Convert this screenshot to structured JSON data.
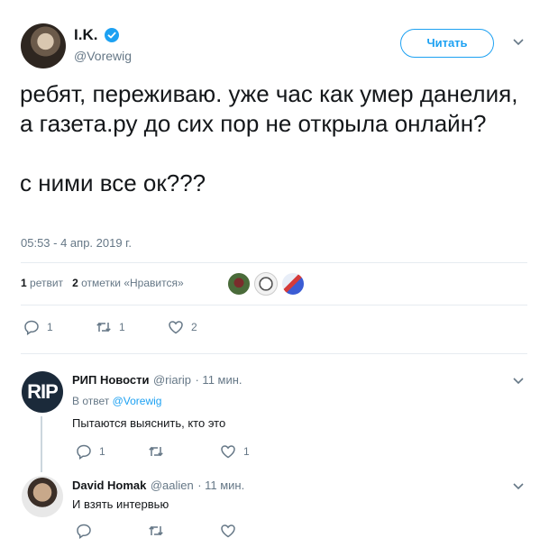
{
  "tweet": {
    "author_name": "I.K.",
    "author_handle": "@Vorewig",
    "follow_label": "Читать",
    "text": "ребят, переживаю. уже час как умер данелия, а газета.ру до сих пор не открыла онлайн?\n\nс ними все ок???",
    "timestamp": "05:53 - 4 апр. 2019 г.",
    "retweets_count": "1",
    "retweets_label": "ретвит",
    "likes_count": "2",
    "likes_label": "отметки «Нравится»",
    "actions": {
      "replies": "1",
      "retweets": "1",
      "likes": "2"
    }
  },
  "replies": [
    {
      "name": "РИП Новости",
      "handle": "@riarip",
      "time": "· 11 мин.",
      "reply_to_prefix": "В ответ",
      "reply_to_handle": "@Vorewig",
      "avatar_text": "RIP",
      "text": "Пытаются выяснить, кто это",
      "actions": {
        "replies": "1",
        "retweets": "",
        "likes": "1"
      }
    },
    {
      "name": "David Homak",
      "handle": "@aalien",
      "time": "· 11 мин.",
      "text": "И взять интервью",
      "actions": {
        "replies": "",
        "retweets": "",
        "likes": ""
      }
    }
  ],
  "colors": {
    "accent": "#1da1f2",
    "muted": "#657786",
    "text": "#14171a",
    "divider": "#e6ecf0"
  },
  "icons": [
    "verified-badge-icon",
    "chevron-down-icon",
    "reply-icon",
    "retweet-icon",
    "heart-icon"
  ]
}
